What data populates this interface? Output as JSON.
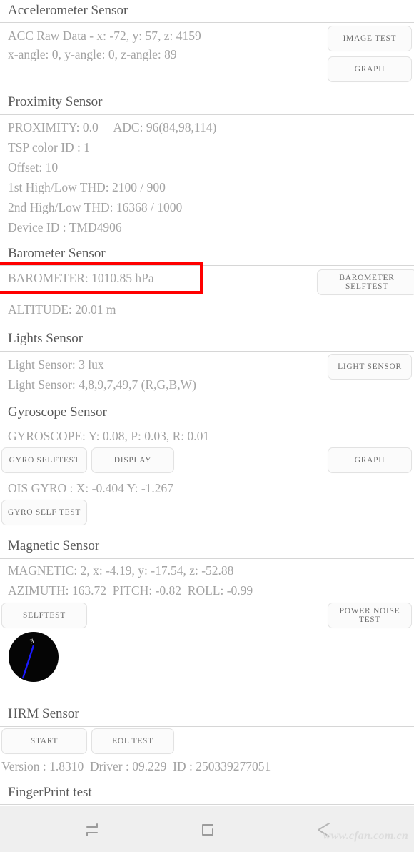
{
  "screen": {
    "background": "#ffffff",
    "body_text_color": "#a3a3a3",
    "title_text_color": "#5a5a5a",
    "highlight_color": "#ff0000"
  },
  "sections": [
    {
      "title": "Accelerometer Sensor",
      "lines": [
        "ACC Raw Data - x: -72, y: 57, z: 4159",
        "x-angle: 0, y-angle: 0, z-angle: 89"
      ],
      "buttons": [
        "IMAGE TEST",
        "GRAPH"
      ]
    },
    {
      "title": "Proximity Sensor",
      "lines": [
        "PROXIMITY: 0.0     ADC: 96(84,98,114)",
        "TSP color ID : 1",
        "Offset: 10",
        "1st High/Low THD: 2100 / 900",
        "2nd High/Low THD: 16368 / 1000",
        "Device ID : TMD4906"
      ],
      "buttons": []
    },
    {
      "title": "Barometer Sensor",
      "lines": [
        "BAROMETER: 1010.85 hPa",
        "ALTITUDE: 20.01 m"
      ],
      "buttons": [
        "BAROMETER SELFTEST"
      ]
    },
    {
      "title": "Lights Sensor",
      "lines": [
        "Light Sensor: 3 lux",
        "Light Sensor: 4,8,9,7,49,7 (R,G,B,W)"
      ],
      "buttons": [
        "LIGHT SENSOR"
      ]
    },
    {
      "title": "Gyroscope Sensor",
      "lines": [
        "GYROSCOPE: Y: 0.08, P: 0.03, R: 0.01",
        "OIS GYRO : X: -0.404 Y: -1.267"
      ],
      "buttons": [
        "GYRO SELFTEST",
        "DISPLAY",
        "GRAPH",
        "GYRO SELF TEST"
      ]
    },
    {
      "title": "Magnetic Sensor",
      "lines": [
        "MAGNETIC: 2, x: -4.19, y: -17.54, z: -52.88",
        "AZIMUTH: 163.72  PITCH: -0.82  ROLL: -0.99"
      ],
      "buttons": [
        "SELFTEST",
        "POWER NOISE TEST"
      ]
    },
    {
      "title": "HRM Sensor",
      "lines": [
        "Version : 1.8310  Driver : 09.229  ID : 250339277051"
      ],
      "buttons": [
        "START",
        "EOL TEST"
      ]
    },
    {
      "title": "FingerPrint test",
      "lines": [],
      "buttons": []
    }
  ],
  "accelerometer": {
    "title": "Accelerometer Sensor",
    "raw": "ACC Raw Data - x: -72, y: 57, z: 4159",
    "angles": "x-angle: 0, y-angle: 0, z-angle: 89",
    "btn_image_test": "IMAGE TEST",
    "btn_graph": "GRAPH"
  },
  "proximity": {
    "title": "Proximity Sensor",
    "line1": "PROXIMITY: 0.0     ADC: 96(84,98,114)",
    "line2": "TSP color ID : 1",
    "line3": "Offset: 10",
    "line4": "1st High/Low THD: 2100 / 900",
    "line5": "2nd High/Low THD: 16368 / 1000",
    "line6": "Device ID : TMD4906"
  },
  "barometer": {
    "title": "Barometer Sensor",
    "pressure": "BAROMETER: 1010.85 hPa",
    "altitude": "ALTITUDE: 20.01 m",
    "btn_selftest": "BAROMETER SELFTEST"
  },
  "lights": {
    "title": "Lights Sensor",
    "lux": "Light Sensor: 3 lux",
    "rgbw": "Light Sensor: 4,8,9,7,49,7 (R,G,B,W)",
    "btn_light_sensor": "LIGHT SENSOR"
  },
  "gyroscope": {
    "title": "Gyroscope Sensor",
    "ypr": "GYROSCOPE: Y: 0.08, P: 0.03, R: 0.01",
    "ois": "OIS GYRO : X: -0.404 Y: -1.267",
    "btn_gyro_selftest": "GYRO SELFTEST",
    "btn_display": "DISPLAY",
    "btn_graph": "GRAPH",
    "btn_gyro_self_test": "GYRO SELF TEST"
  },
  "magnetic": {
    "title": "Magnetic Sensor",
    "values": "MAGNETIC: 2, x: -4.19, y: -17.54, z: -52.88",
    "orientation": "AZIMUTH: 163.72  PITCH: -0.82  ROLL: -0.99",
    "btn_selftest": "SELFTEST",
    "btn_power_noise": "POWER NOISE TEST",
    "compass": {
      "label": "E",
      "needle_color": "#1a1aff",
      "dial_color": "#050505",
      "azimuth": 163.72
    }
  },
  "hrm": {
    "title": "HRM Sensor",
    "btn_start": "START",
    "btn_eol_test": "EOL TEST",
    "version_line": "Version : 1.8310  Driver : 09.229  ID : 250339277051"
  },
  "fingerprint": {
    "title": "FingerPrint test"
  },
  "navbar": {
    "recents_icon": "recents-icon",
    "home_icon": "home-icon",
    "back_icon": "back-icon"
  },
  "watermark": {
    "text": "www.cfan.com.cn"
  }
}
